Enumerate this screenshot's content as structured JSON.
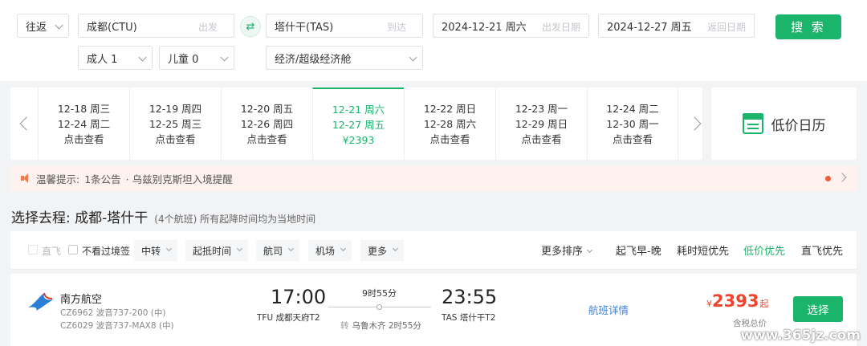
{
  "search": {
    "trip_type": "往返",
    "from_value": "成都(CTU)",
    "from_hint": "出发",
    "to_value": "塔什干(TAS)",
    "to_hint": "到达",
    "depart_date": "2024-12-21 周六",
    "depart_hint": "出发日期",
    "return_date": "2024-12-27 周五",
    "return_hint": "返回日期",
    "search_label": "搜 索",
    "adults": "成人 1",
    "children": "儿童 0",
    "cabin": "经济/超级经济舱",
    "swap_icon": "swap-icon"
  },
  "dates": [
    {
      "out": "12-18 周三",
      "ret": "12-24 周二",
      "price": "点击查看"
    },
    {
      "out": "12-19 周四",
      "ret": "12-25 周三",
      "price": "点击查看"
    },
    {
      "out": "12-20 周五",
      "ret": "12-26 周四",
      "price": "点击查看"
    },
    {
      "out": "12-21 周六",
      "ret": "12-27 周五",
      "price": "¥2393"
    },
    {
      "out": "12-22 周日",
      "ret": "12-28 周六",
      "price": "点击查看"
    },
    {
      "out": "12-23 周一",
      "ret": "12-29 周日",
      "price": "点击查看"
    },
    {
      "out": "12-24 周二",
      "ret": "12-30 周一",
      "price": "点击查看"
    }
  ],
  "calendar_label": "低价日历",
  "notice": {
    "prefix": "温馨提示:",
    "count": "1条公告",
    "text": "· 乌兹别克斯坦入境提醒"
  },
  "heading": {
    "title": "选择去程: 成都-塔什干",
    "sub": "(4个航班) 所有起降时间均为当地时间"
  },
  "filters": {
    "direct": "直飞",
    "no_transit_visa": "不看过境签",
    "dropdowns": [
      "中转",
      "起抵时间",
      "航司",
      "机场",
      "更多"
    ],
    "sorts": [
      "更多排序",
      "起飞早-晚",
      "耗时短优先",
      "低价优先",
      "直飞优先"
    ]
  },
  "flight": {
    "airline": "南方航空",
    "flight1": "CZ6962 波音737-200 (中)",
    "flight2": "CZ6029 波音737-MAX8 (中)",
    "dep_time": "17:00",
    "dep_airport": "TFU 成都天府T2",
    "duration": "9时55分",
    "arr_time": "23:55",
    "arr_airport": "TAS 塔什干T2",
    "stop_tag": "转",
    "stop": "乌鲁木齐 2时55分",
    "detail": "航班详情",
    "currency": "¥",
    "price": "2393",
    "price_suffix": "起",
    "tax": "含税总价",
    "select": "选择"
  },
  "watermark": "www.365jz.com",
  "colors": {
    "accent": "#1ab46b",
    "price": "#f0432c",
    "link": "#3d7fd6",
    "notice_bg": "#fdf2ee"
  }
}
